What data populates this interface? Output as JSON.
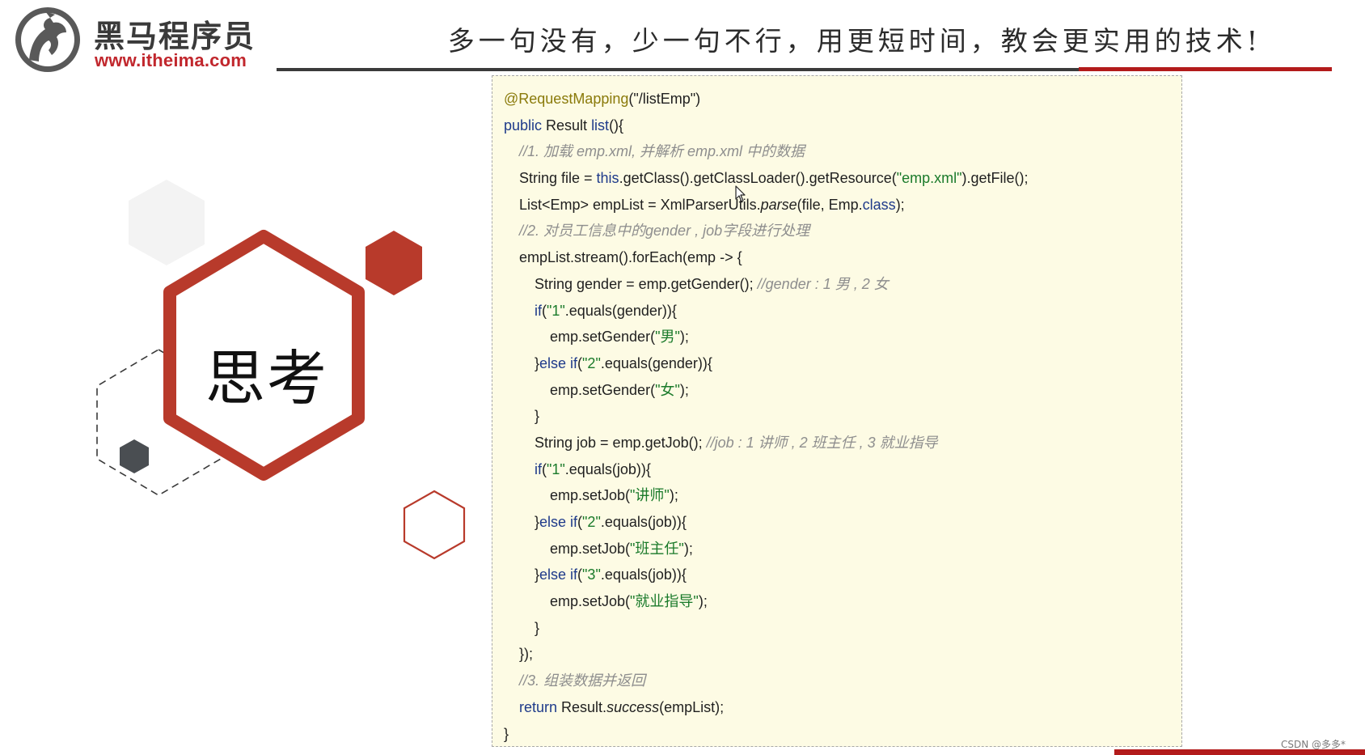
{
  "header": {
    "brand_name": "黑马程序员",
    "brand_url": "www.itheima.com",
    "slogan": "多一句没有，少一句不行，用更短时间，教会更实用的技术!"
  },
  "slide": {
    "think_label": "思考"
  },
  "code": {
    "annotation": "@RequestMapping",
    "annotation_arg": "(\"/listEmp\")",
    "kw_public": "public",
    "sig_rest": " Result ",
    "method_name": "list",
    "sig_end": "(){",
    "comment1": "//1. 加载 emp.xml, 并解析 emp.xml 中的数据",
    "l4_a": "String file = ",
    "kw_this": "this",
    "l4_b": ".getClass().getClassLoader().getResource(",
    "str_emp_xml": "\"emp.xml\"",
    "l4_c": ").getFile();",
    "l5_a": "List<Emp> empList = XmlParserUtils.",
    "parse": "parse",
    "l5_b": "(file, Emp.",
    "kw_class": "class",
    "l5_c": ");",
    "comment2": "//2. 对员工信息中的gender , job字段进行处理",
    "l7": "empList.stream().forEach(emp -> {",
    "l8_a": "String gender = emp.getGender(); ",
    "comment_gender": "//gender : 1 男 , 2 女",
    "kw_if": "if",
    "str_1": "\"1\"",
    "eq_gender": ".equals(gender)){",
    "set_gender_a": "emp.setGender(",
    "str_male": "\"男\"",
    "stmt_end": ");",
    "close_else": "}",
    "kw_else_if": "else if",
    "str_2": "\"2\"",
    "str_female": "\"女\"",
    "close_brace": "}",
    "l16_a": "String job = emp.getJob(); ",
    "comment_job": "//job : 1 讲师 , 2 班主任 , 3 就业指导",
    "eq_job": ".equals(job)){",
    "set_job_a": "emp.setJob(",
    "str_teacher": "\"讲师\"",
    "str_head_teacher": "\"班主任\"",
    "str_3": "\"3\"",
    "str_career": "\"就业指导\"",
    "close_lambda": "});",
    "comment3": "//3. 组装数据并返回",
    "kw_return": "return",
    "ret_a": " Result.",
    "success": "success",
    "ret_b": "(empList);",
    "final_close": "}"
  },
  "watermark": "CSDN @多多*",
  "colors": {
    "brand_red": "#c1272d",
    "hex_red": "#b83a2b",
    "code_bg": "#fdfbe4",
    "annotation": "#8a7a0a",
    "string": "#1a7a2a",
    "keyword": "#1e3a8a",
    "comment": "#8e8e8e"
  },
  "icons": [
    "horse-logo-icon",
    "mouse-cursor-icon"
  ]
}
